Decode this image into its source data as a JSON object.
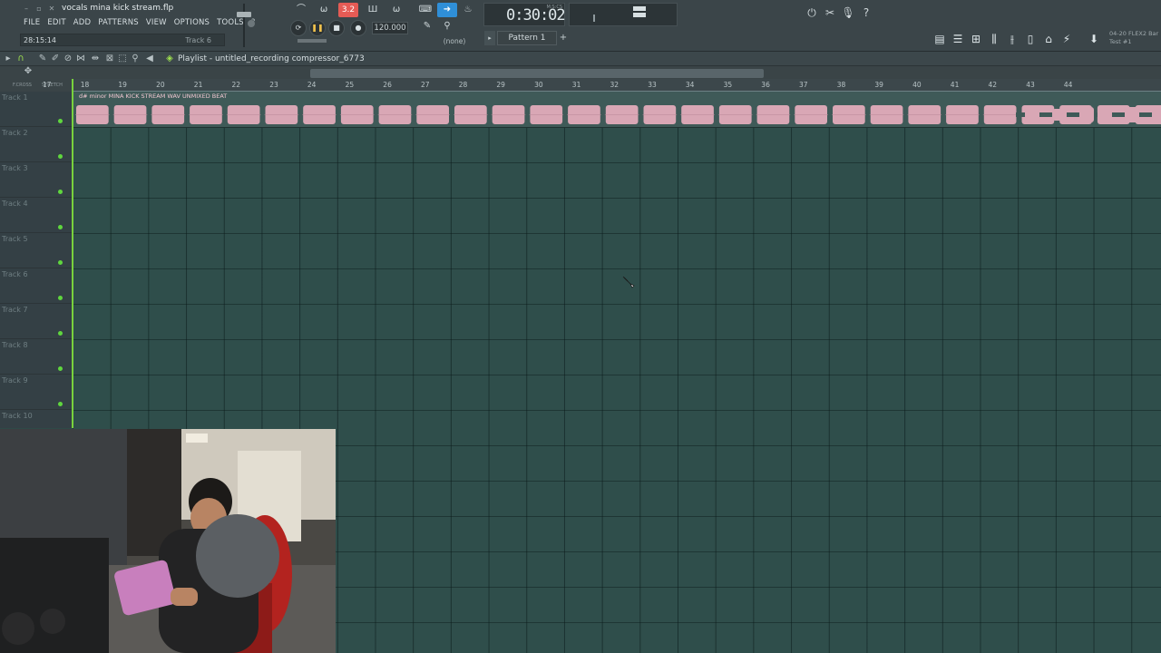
{
  "window": {
    "file_title": "vocals mina kick stream.flp",
    "menu": [
      "FILE",
      "EDIT",
      "ADD",
      "PATTERNS",
      "VIEW",
      "OPTIONS",
      "TOOLS",
      "?"
    ],
    "hint_time": "28:15:14",
    "hint_target": "Track 6"
  },
  "transport": {
    "song_time": "0:30:02",
    "time_mode": "M:S:CS",
    "tempo": "120.000",
    "pattern_name": "Pattern 1",
    "snap_none": "(none)",
    "record_badge": "3.2"
  },
  "news": {
    "line1": "04-20  FLEX2 Bar",
    "line2": "Test #1"
  },
  "playlist": {
    "title": "Playlist - untitled_recording compressor_6773",
    "snap_label_1": "F.CROSS",
    "snap_label_2": "STRETCH",
    "bar_numbers": [
      "17",
      "18",
      "19",
      "20",
      "21",
      "22",
      "23",
      "24",
      "25",
      "26",
      "27",
      "28",
      "29",
      "30",
      "31",
      "32",
      "33",
      "34",
      "35",
      "36",
      "37",
      "38",
      "39",
      "40",
      "41",
      "42",
      "43",
      "44"
    ],
    "tracks": [
      "Track 1",
      "Track 2",
      "Track 3",
      "Track 4",
      "Track 5",
      "Track 6",
      "Track 7",
      "Track 8",
      "Track 9",
      "Track 10"
    ],
    "clip": {
      "title": "d# minor MINA KICK STREAM WAV UNMIXED BEAT",
      "color": "#d9a7b5"
    }
  },
  "colors": {
    "grid_bg": "#2f4e4b",
    "playhead": "#78d23d",
    "accent_blue": "#2f8fd8",
    "accent_red": "#e55b55"
  }
}
